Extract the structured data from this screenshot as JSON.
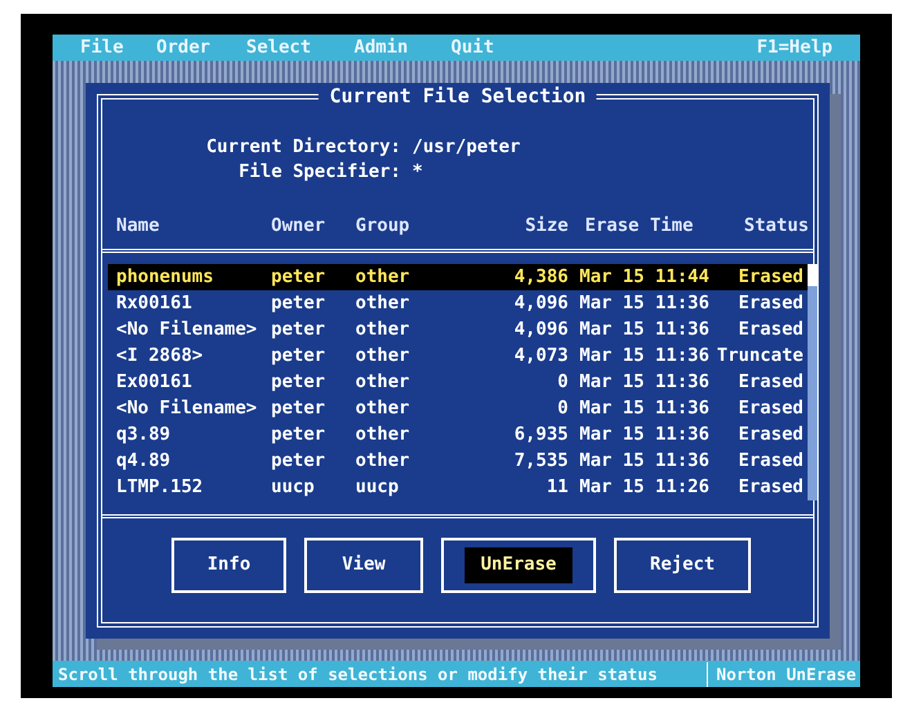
{
  "menu_bar": {
    "items": [
      "File",
      "Order",
      "Select",
      "Admin",
      "Quit"
    ],
    "help": "F1=Help"
  },
  "dialog": {
    "title": "Current File Selection",
    "fields": [
      {
        "label": "Current Directory:",
        "value": "/usr/peter"
      },
      {
        "label": "File Specifier:",
        "value": "*"
      }
    ],
    "columns": [
      "Name",
      "Owner",
      "Group",
      "Size",
      "Erase Time",
      "Status"
    ],
    "rows": [
      {
        "name": "phonenums",
        "owner": "peter",
        "group": "other",
        "size": "4,386",
        "erase_time": "Mar 15 11:44",
        "status": "Erased",
        "selected": true
      },
      {
        "name": "Rx00161",
        "owner": "peter",
        "group": "other",
        "size": "4,096",
        "erase_time": "Mar 15 11:36",
        "status": "Erased",
        "selected": false
      },
      {
        "name": "<No Filename>",
        "owner": "peter",
        "group": "other",
        "size": "4,096",
        "erase_time": "Mar 15 11:36",
        "status": "Erased",
        "selected": false
      },
      {
        "name": "<I 2868>",
        "owner": "peter",
        "group": "other",
        "size": "4,073",
        "erase_time": "Mar 15 11:36",
        "status": "Truncate",
        "selected": false
      },
      {
        "name": "Ex00161",
        "owner": "peter",
        "group": "other",
        "size": "0",
        "erase_time": "Mar 15 11:36",
        "status": "Erased",
        "selected": false
      },
      {
        "name": "<No Filename>",
        "owner": "peter",
        "group": "other",
        "size": "0",
        "erase_time": "Mar 15 11:36",
        "status": "Erased",
        "selected": false
      },
      {
        "name": "q3.89",
        "owner": "peter",
        "group": "other",
        "size": "6,935",
        "erase_time": "Mar 15 11:36",
        "status": "Erased",
        "selected": false
      },
      {
        "name": "q4.89",
        "owner": "peter",
        "group": "other",
        "size": "7,535",
        "erase_time": "Mar 15 11:36",
        "status": "Erased",
        "selected": false
      },
      {
        "name": "LTMP.152",
        "owner": "uucp",
        "group": "uucp",
        "size": "11",
        "erase_time": "Mar 15 11:26",
        "status": "Erased",
        "selected": false
      }
    ],
    "buttons": [
      {
        "label": "Info",
        "selected": false
      },
      {
        "label": "View",
        "selected": false
      },
      {
        "label": "UnErase",
        "selected": true
      },
      {
        "label": "Reject",
        "selected": false
      }
    ]
  },
  "status_bar": {
    "message": "Scroll through the list of selections or modify their status",
    "program": "Norton UnErase"
  }
}
